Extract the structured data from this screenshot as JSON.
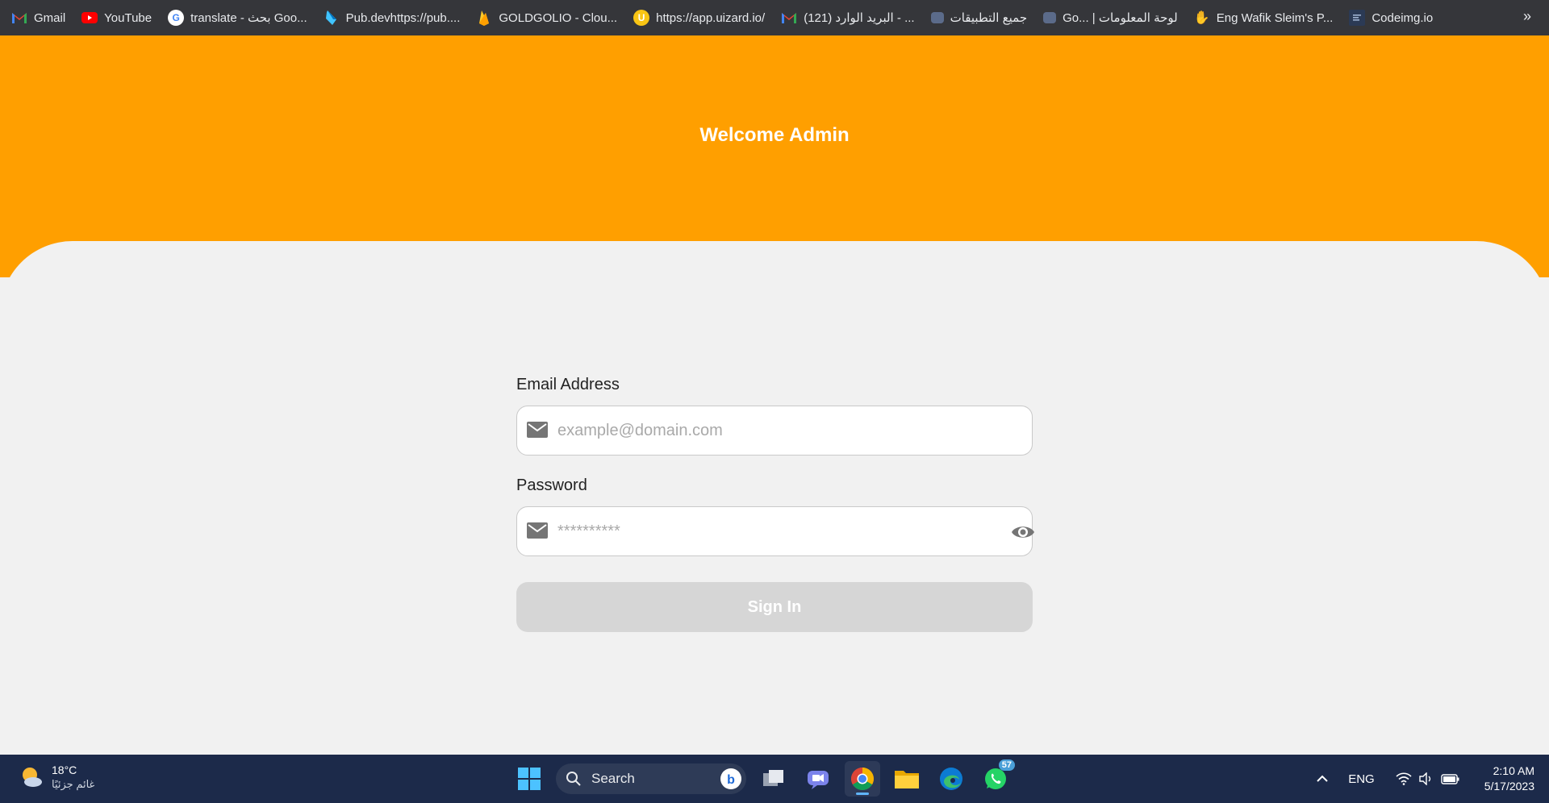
{
  "bookmarks": {
    "items": [
      {
        "label": "Gmail",
        "icon": "gmail-icon",
        "color": "#d93025"
      },
      {
        "label": "YouTube",
        "icon": "youtube-icon",
        "color": "#ff0000"
      },
      {
        "label": "translate - بحث Goo...",
        "icon": "google-icon",
        "color": "#4285f4"
      },
      {
        "label": "Pub.devhttps://pub....",
        "icon": "dart-icon",
        "color": "#0175c2"
      },
      {
        "label": "GOLDGOLIO - Clou...",
        "icon": "firebase-icon",
        "color": "#ffca28"
      },
      {
        "label": "https://app.uizard.io/",
        "icon": "uizard-icon",
        "color": "#f9c514"
      },
      {
        "label": "(121) البريد الوارد - ...",
        "icon": "gmail-icon",
        "color": "#d93025"
      },
      {
        "label": "جميع التطبيقات",
        "icon": "app-icon",
        "color": "#5b6b8a"
      },
      {
        "label": "Go... | لوحة المعلومات",
        "icon": "app-icon",
        "color": "#5b6b8a"
      },
      {
        "label": "Eng Wafik Sleim's P...",
        "icon": "hand-icon",
        "color": "#f5c542"
      },
      {
        "label": "Codeimg.io",
        "icon": "codeimg-icon",
        "color": "#2b3a55"
      }
    ],
    "more": "»"
  },
  "header": {
    "title": "Welcome Admin",
    "color": "#ff9f00"
  },
  "form": {
    "email_label": "Email Address",
    "email_placeholder": "example@domain.com",
    "password_label": "Password",
    "password_placeholder": "**********",
    "signin_label": "Sign In"
  },
  "taskbar": {
    "weather_temp": "18°C",
    "weather_cond": "غائم جزئيًا",
    "search_label": "Search",
    "whatsapp_badge": "57",
    "lang": "ENG",
    "time": "2:10 AM",
    "date": "5/17/2023"
  }
}
